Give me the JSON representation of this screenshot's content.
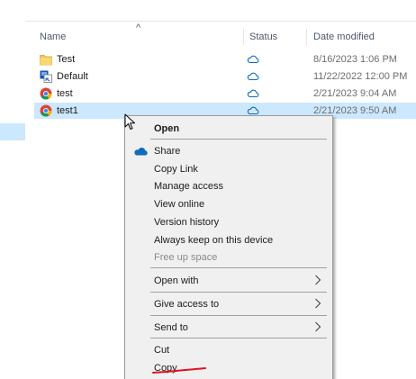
{
  "header": {
    "sort_caret": "^",
    "name": "Name",
    "status": "Status",
    "date_modified": "Date modified"
  },
  "files": [
    {
      "name": "Test",
      "date": "8/16/2023 1:06 PM",
      "icon": "folder-icon",
      "status_icon": "cloud-icon"
    },
    {
      "name": "Default",
      "date": "11/22/2022 12:00 PM",
      "icon": "shortcut-icon",
      "status_icon": "cloud-icon"
    },
    {
      "name": "test",
      "date": "2/21/2023 9:04 AM",
      "icon": "chrome-icon",
      "status_icon": "cloud-icon"
    },
    {
      "name": "test1",
      "date": "2/21/2023 9:50 AM",
      "icon": "chrome-icon",
      "status_icon": "cloud-icon"
    }
  ],
  "context_menu": {
    "open": "Open",
    "share": "Share",
    "copy_link": "Copy Link",
    "manage_access": "Manage access",
    "view_online": "View online",
    "version_history": "Version history",
    "always_keep": "Always keep on this device",
    "free_up_space": "Free up space",
    "open_with": "Open with",
    "give_access_to": "Give access to",
    "send_to": "Send to",
    "cut": "Cut",
    "copy": "Copy"
  },
  "colors": {
    "selection": "#cce8ff",
    "menu_background": "#f0f0f0",
    "onedrive_blue": "#0f6cbd",
    "annotation_red": "#e0121e",
    "folder_yellow": "#f3c85a"
  }
}
